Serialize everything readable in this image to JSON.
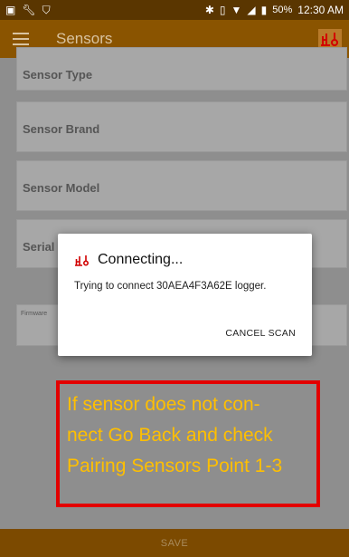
{
  "status_bar": {
    "battery": "50%",
    "time": "12:30 AM"
  },
  "app_bar": {
    "title": "Sensors"
  },
  "form": {
    "sensor_type": "Sensor Type",
    "sensor_brand": "Sensor Brand",
    "sensor_model": "Sensor Model",
    "serial": "Serial",
    "firmware": "Firmware"
  },
  "bottom_bar": {
    "save_label": "SAVE"
  },
  "dialog": {
    "title": "Connecting...",
    "message": "Trying to connect 30AEA4F3A62E logger.",
    "cancel_label": "CANCEL SCAN"
  },
  "annotation": {
    "line1": "If sensor does not con-",
    "line2": "nect Go Back and check",
    "line3": "Pairing Sensors Point 1-3"
  },
  "colors": {
    "app_bar": "#8a5400",
    "status_bar": "#5a3600",
    "annotation_border": "#e30000",
    "annotation_text": "#ffbf00",
    "logo": "#d10000"
  }
}
